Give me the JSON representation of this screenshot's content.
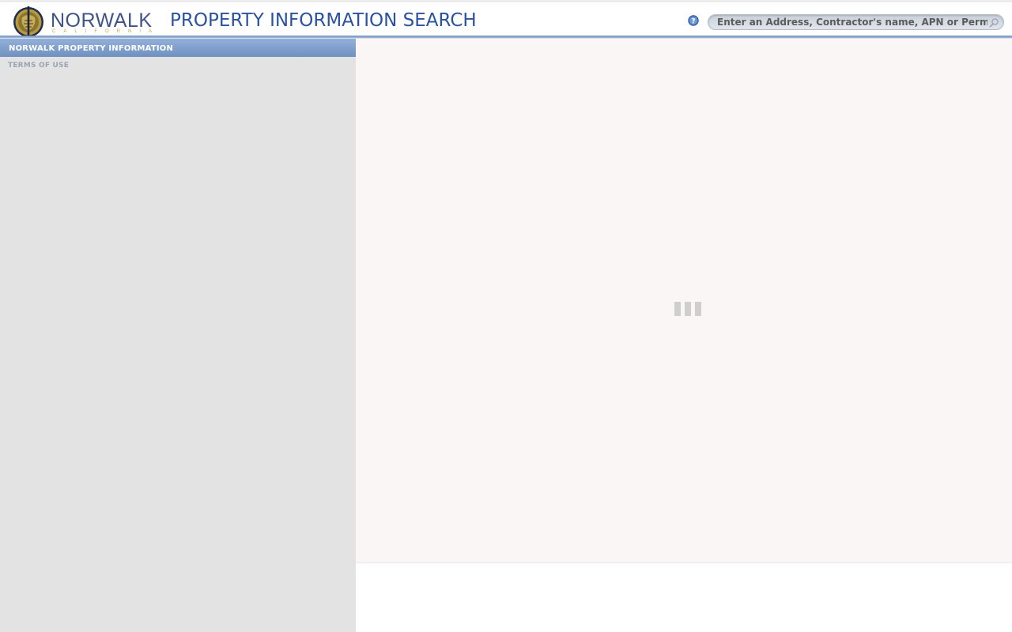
{
  "header": {
    "logo": {
      "name": "NORWALK",
      "subtitle": "CALIFORNIA"
    },
    "title": "PROPERTY INFORMATION SEARCH",
    "help_icon": "help-icon",
    "search": {
      "placeholder": "Enter an Address, Contractor's name, APN or Permit Number",
      "value": "",
      "icon": "search-icon"
    }
  },
  "sidebar": {
    "header": "NORWALK PROPERTY INFORMATION",
    "items": [
      {
        "label": "TERMS OF USE"
      }
    ]
  },
  "main": {
    "loading_icon": "loading-spinner-icon"
  },
  "colors": {
    "title_blue": "#2b52a1",
    "header_rule": "#6d8dbf",
    "sidebar_bg": "#e3e3e3",
    "content_bg": "#f9f6f5",
    "logo_gold": "#c4a549"
  }
}
